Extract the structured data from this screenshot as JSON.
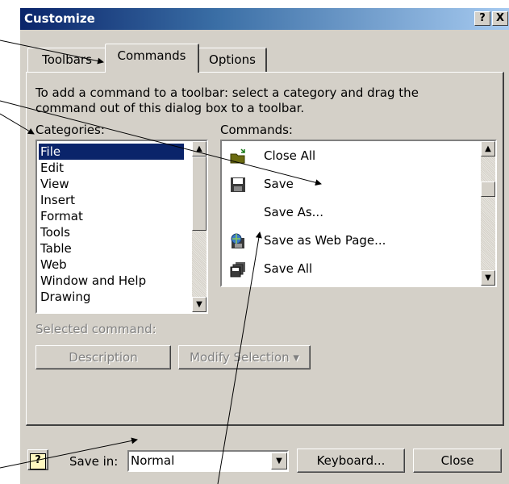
{
  "window": {
    "title": "Customize",
    "help_btn": "?",
    "close_btn": "X"
  },
  "tabs": [
    {
      "label": "Toolbars"
    },
    {
      "label": "Commands"
    },
    {
      "label": "Options"
    }
  ],
  "instructions": "To add a command to a toolbar: select a category and drag the command out of this dialog box to a toolbar.",
  "categories": {
    "label": "Categories:",
    "items": [
      "File",
      "Edit",
      "View",
      "Insert",
      "Format",
      "Tools",
      "Table",
      "Web",
      "Window and Help",
      "Drawing"
    ],
    "selected": "File"
  },
  "commands": {
    "label": "Commands:",
    "items": [
      {
        "label": "Close All",
        "icon": "close-all-icon"
      },
      {
        "label": "Save",
        "icon": "save-icon"
      },
      {
        "label": "Save As...",
        "icon": ""
      },
      {
        "label": "Save as Web Page...",
        "icon": "save-web-page-icon"
      },
      {
        "label": "Save All",
        "icon": "save-all-icon"
      }
    ]
  },
  "selected_command": {
    "label": "Selected command:",
    "description_button": "Description",
    "modify_button": "Modify Selection",
    "modify_arrow": "▾"
  },
  "footer": {
    "help_icon": "?",
    "save_in_label": "Save in:",
    "save_in_value": "Normal",
    "keyboard_button": "Keyboard...",
    "close_button": "Close"
  },
  "scroll_arrows": {
    "up": "▲",
    "down": "▼"
  },
  "colors": {
    "titlebar": "#0a246a",
    "face": "#d4d0c8",
    "selection": "#0a246a"
  }
}
